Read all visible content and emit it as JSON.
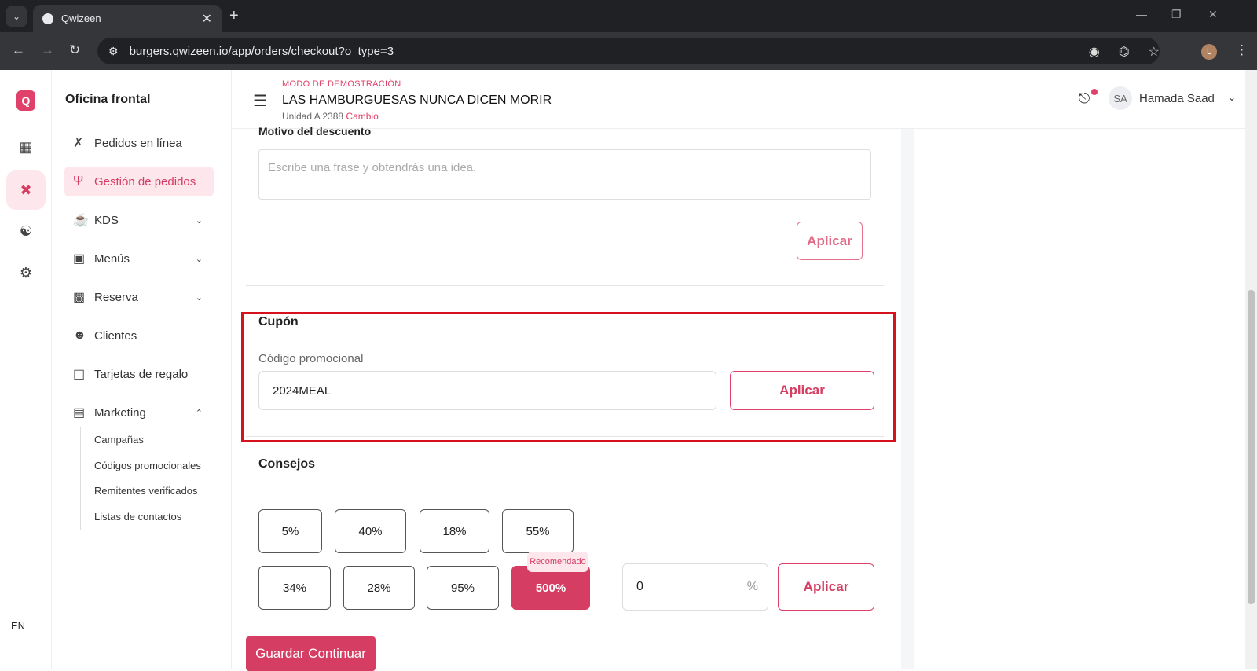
{
  "browser": {
    "tab_title": "Qwizeen",
    "url": "burgers.qwizeen.io/app/orders/checkout?o_type=3",
    "profile_initial": "L"
  },
  "rail": {
    "logo": "Q",
    "language": "EN",
    "icons": [
      "dashboard-icon",
      "orders-icon",
      "network-icon",
      "settings-icon"
    ]
  },
  "sidebar": {
    "title": "Oficina frontal",
    "items": [
      {
        "label": "Pedidos en línea",
        "icon": "cutlery-cross-icon"
      },
      {
        "label": "Gestión de pedidos",
        "icon": "fork-knife-icon",
        "active": true
      },
      {
        "label": "KDS",
        "icon": "chef-hat-icon"
      },
      {
        "label": "Menús",
        "icon": "grid-icon"
      },
      {
        "label": "Reserva",
        "icon": "table-icon"
      },
      {
        "label": "Clientes",
        "icon": "users-icon"
      },
      {
        "label": "Tarjetas de regalo",
        "icon": "gift-icon"
      },
      {
        "label": "Marketing",
        "icon": "chart-icon"
      }
    ],
    "marketing_sub": [
      "Campañas",
      "Códigos promocionales",
      "Remitentes verificados",
      "Listas de contactos"
    ]
  },
  "header": {
    "demo_mode": "MODO DE DEMOSTRACIÓN",
    "store_name": "LAS HAMBURGUESAS NUNCA DICEN MORIR",
    "unit": "Unidad A 2388",
    "change": "Cambio",
    "avatar": "SA",
    "user_name": "Hamada Saad"
  },
  "discount": {
    "reason_label": "Motivo del descuento",
    "reason_placeholder": "Escribe una frase y obtendrás una idea.",
    "apply": "Aplicar"
  },
  "coupon": {
    "title": "Cupón",
    "field_label": "Código promocional",
    "value": "2024MEAL",
    "apply": "Aplicar"
  },
  "tips": {
    "title": "Consejos",
    "row1": [
      "5%",
      "40%",
      "18%",
      "55%"
    ],
    "row2": [
      "34%",
      "28%",
      "95%",
      "500%"
    ],
    "recommended": "Recomendado",
    "custom_value": "0",
    "custom_unit": "%",
    "apply": "Aplicar"
  },
  "save_continue": "Guardar Continuar",
  "colors": {
    "accent": "#d63d62",
    "highlight": "#d7121f"
  }
}
